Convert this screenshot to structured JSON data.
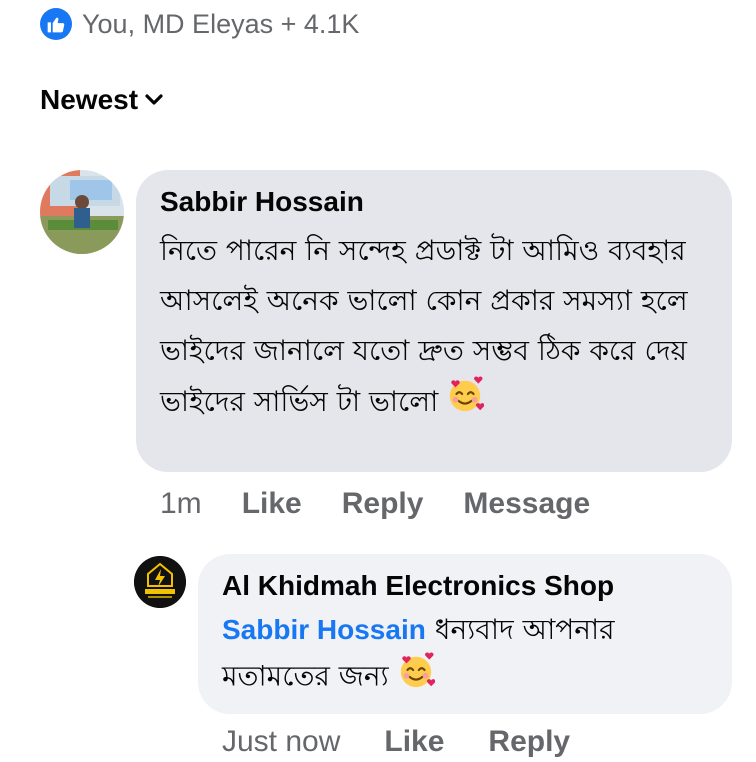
{
  "reactions": {
    "icon": "like-icon",
    "summary": "You, MD Eleyas + 4.1K"
  },
  "sort": {
    "label": "Newest"
  },
  "comment": {
    "author": "Sabbir Hossain",
    "text": "নিতে পারেন নি সন্দেহ প্রডাক্ট টা আমিও ব্যবহার আসলেই অনেক ভালো কোন প্রকার সমস্যা হলে ভাইদের জানালে যতো দ্রুত সম্ভব ঠিক করে দেয় ভাইদের সার্ভিস টা ভালো",
    "emoji": "smiling-face-with-hearts",
    "time": "1m",
    "like_label": "Like",
    "reply_label": "Reply",
    "message_label": "Message"
  },
  "reply": {
    "author": "Al Khidmah Electronics Shop",
    "avatar_text": "Al Khidmah",
    "mention": "Sabbir Hossain",
    "text": "ধন্যবাদ আপনার মতামতের জন্য",
    "emoji": "smiling-face-with-hearts",
    "time": "Just now",
    "like_label": "Like",
    "reply_label": "Reply"
  },
  "colors": {
    "accent": "#1877f2",
    "bubble": "#e4e6eb",
    "reply_bubble": "#f0f2f5",
    "muted": "#65676b"
  }
}
